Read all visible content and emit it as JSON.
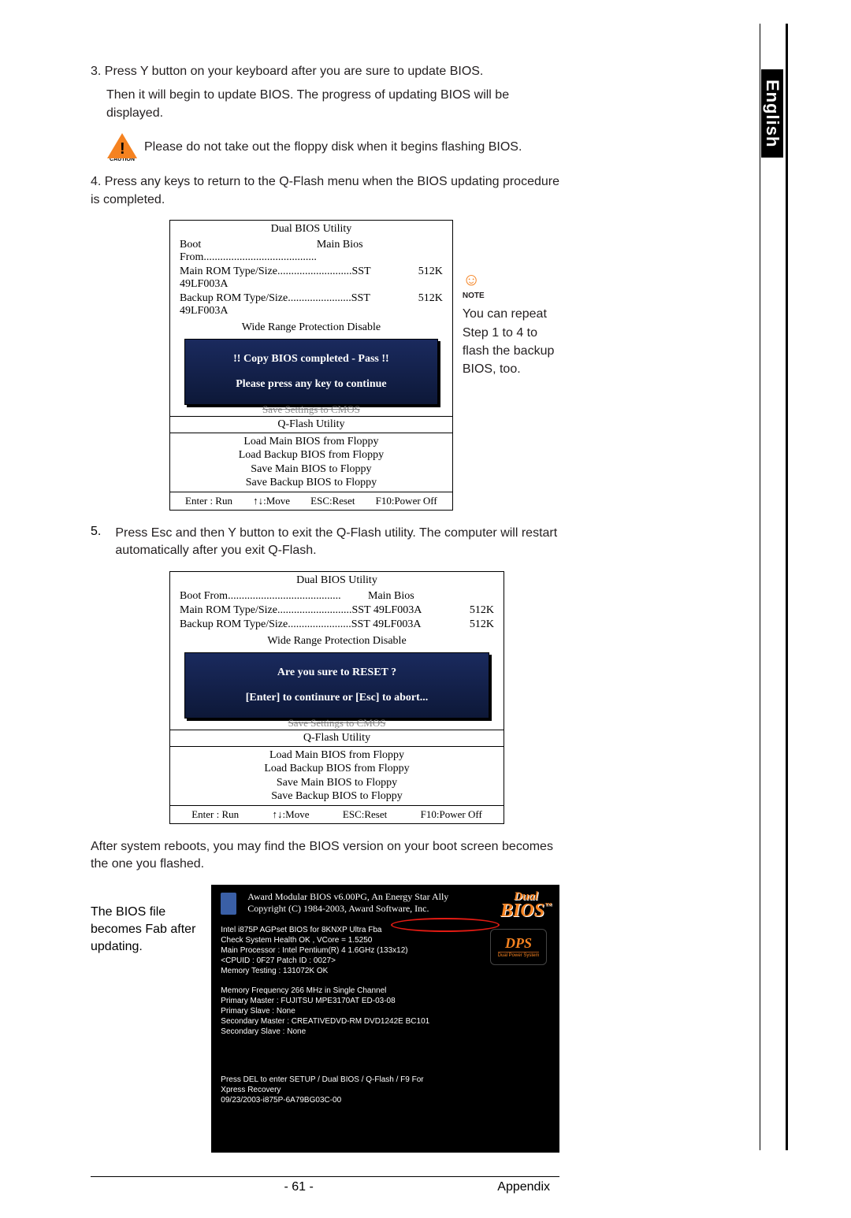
{
  "side_tab": "English",
  "steps": {
    "s3": "3. Press Y button on your keyboard after you are sure to update BIOS.",
    "s3b": "Then it will begin to update BIOS. The progress of updating BIOS will be displayed.",
    "caution_text": "Please do not take out the floppy disk when it begins flashing BIOS.",
    "caution_label": "CAUTION",
    "s4": "4. Press any keys to return to the Q-Flash menu when the BIOS updating procedure is completed.",
    "s5_num": "5.",
    "s5": "Press Esc and then Y button to exit the Q-Flash utility. The computer will restart automatically after you exit Q-Flash."
  },
  "note": {
    "label": "NOTE",
    "text": "You can repeat Step 1 to 4 to flash the backup BIOS, too."
  },
  "bios1": {
    "title": "Dual BIOS Utility",
    "boot_from_label": "Boot From",
    "boot_from_val": "Main Bios",
    "main_rom_label": "Main ROM Type/Size",
    "main_rom_mid": "SST 49LF003A",
    "main_rom_val": "512K",
    "backup_rom_label": "Backup ROM Type/Size",
    "backup_rom_mid": "SST 49LF003A",
    "backup_rom_val": "512K",
    "protection": "Wide Range Protection    Disable",
    "box_line1": "!! Copy BIOS completed - Pass !!",
    "box_line2": "Please press any key to continue",
    "crossed": "Save Settings to CMOS",
    "qtitle": "Q-Flash Utility",
    "q1": "Load Main BIOS from Floppy",
    "q2": "Load Backup BIOS from Floppy",
    "q3": "Save Main BIOS to Floppy",
    "q4": "Save Backup BIOS to Floppy",
    "k_enter": "Enter : Run",
    "k_move": "↑↓:Move",
    "k_esc": "ESC:Reset",
    "k_f10": "F10:Power Off"
  },
  "bios2": {
    "box_line1": "Are you sure to RESET ?",
    "box_line2": "[Enter] to continure or [Esc] to abort..."
  },
  "after_text": "After system reboots, you may find the BIOS version on your boot screen becomes the one you flashed.",
  "boot_label": "The BIOS file becomes Fab after updating.",
  "boot_panel": {
    "award1": "Award Modular BIOS v6.00PG, An Energy Star Ally",
    "award2": "Copyright  (C) 1984-2003, Award Software,  Inc.",
    "dual": "Dual",
    "bios_txt": "BIOS",
    "dps": "DPS",
    "dps_sub": "Dual Power System",
    "l1": "Intel i875P AGPset BIOS for 8KNXP Ultra Fba",
    "l2": "Check System Health OK , VCore = 1.5250",
    "l3": "Main Processor : Intel Pentium(R) 4  1.6GHz (133x12)",
    "l4": "<CPUID : 0F27 Patch ID  : 0027>",
    "l5": "Memory Testing  : 131072K OK",
    "l6": "Memory Frequency 266 MHz in Single Channel",
    "l7": "Primary Master : FUJITSU MPE3170AT ED-03-08",
    "l8": "Primary Slave : None",
    "l9": "Secondary Master :  CREATIVEDVD-RM DVD1242E BC101",
    "l10": "Secondary Slave : None",
    "l11": "Press DEL to enter SETUP / Dual BIOS / Q-Flash / F9 For",
    "l12": "Xpress Recovery",
    "l13": "09/23/2003-i875P-6A79BG03C-00"
  },
  "footer": {
    "page": "- 61 -",
    "section": "Appendix"
  }
}
